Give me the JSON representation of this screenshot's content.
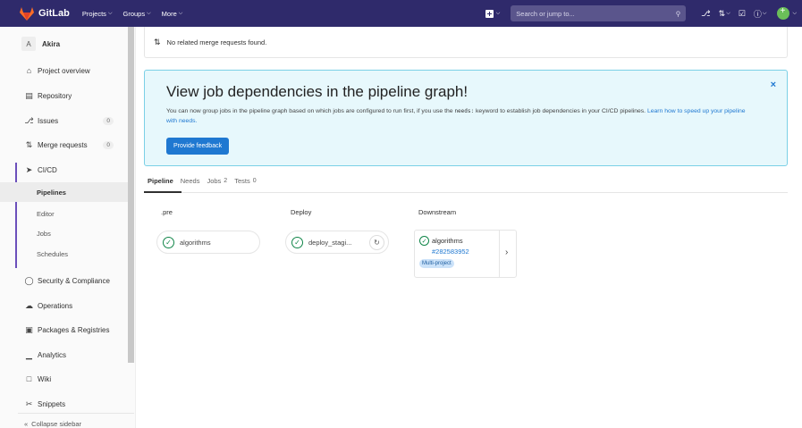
{
  "navbar": {
    "brand": "GitLab",
    "projects_label": "Projects",
    "groups_label": "Groups",
    "more_label": "More",
    "search_placeholder": "Search or jump to..."
  },
  "sidebar": {
    "project_initial": "A",
    "project_name": "Akira",
    "items": [
      {
        "label": "Project overview",
        "icon": "home-icon"
      },
      {
        "label": "Repository",
        "icon": "doc-icon"
      },
      {
        "label": "Issues",
        "icon": "issues-icon",
        "count": "0"
      },
      {
        "label": "Merge requests",
        "icon": "merge-request-icon",
        "count": "0"
      },
      {
        "label": "CI/CD",
        "icon": "rocket-icon"
      },
      {
        "label": "Security & Compliance",
        "icon": "shield-icon"
      },
      {
        "label": "Operations",
        "icon": "cloud-icon"
      },
      {
        "label": "Packages & Registries",
        "icon": "package-icon"
      },
      {
        "label": "Analytics",
        "icon": "chart-icon"
      },
      {
        "label": "Wiki",
        "icon": "book-icon"
      },
      {
        "label": "Snippets",
        "icon": "scissors-icon"
      }
    ],
    "cicd_subitems": [
      "Pipelines",
      "Editor",
      "Jobs",
      "Schedules"
    ],
    "collapse_label": "Collapse sidebar"
  },
  "merge_request_notice": "No related merge requests found.",
  "alert": {
    "title": "View job dependencies in the pipeline graph!",
    "text_before": "You can now group jobs in the pipeline graph based on which jobs are configured to run first, if you use the",
    "code": "needs:",
    "text_after": "keyword to establish job dependencies in your CI/CD pipelines.",
    "link_text": "Learn how to speed up your pipeline with needs.",
    "button_label": "Provide feedback",
    "close_glyph": "×"
  },
  "tabs": [
    {
      "label": "Pipeline"
    },
    {
      "label": "Needs"
    },
    {
      "label": "Jobs",
      "count": "2"
    },
    {
      "label": "Tests",
      "count": "0"
    }
  ],
  "stages": [
    {
      "title": ".pre",
      "job": "algorithms"
    },
    {
      "title": "Deploy",
      "job": "deploy_stagi..."
    },
    {
      "title": "Downstream",
      "job": "algorithms",
      "pipeline_id": "#282583952",
      "badge": "Multi-project"
    }
  ],
  "colors": {
    "navbar": "#2f2a6b",
    "success": "#108548",
    "link": "#1f78d1",
    "alert_bg": "#e7f8fc"
  }
}
